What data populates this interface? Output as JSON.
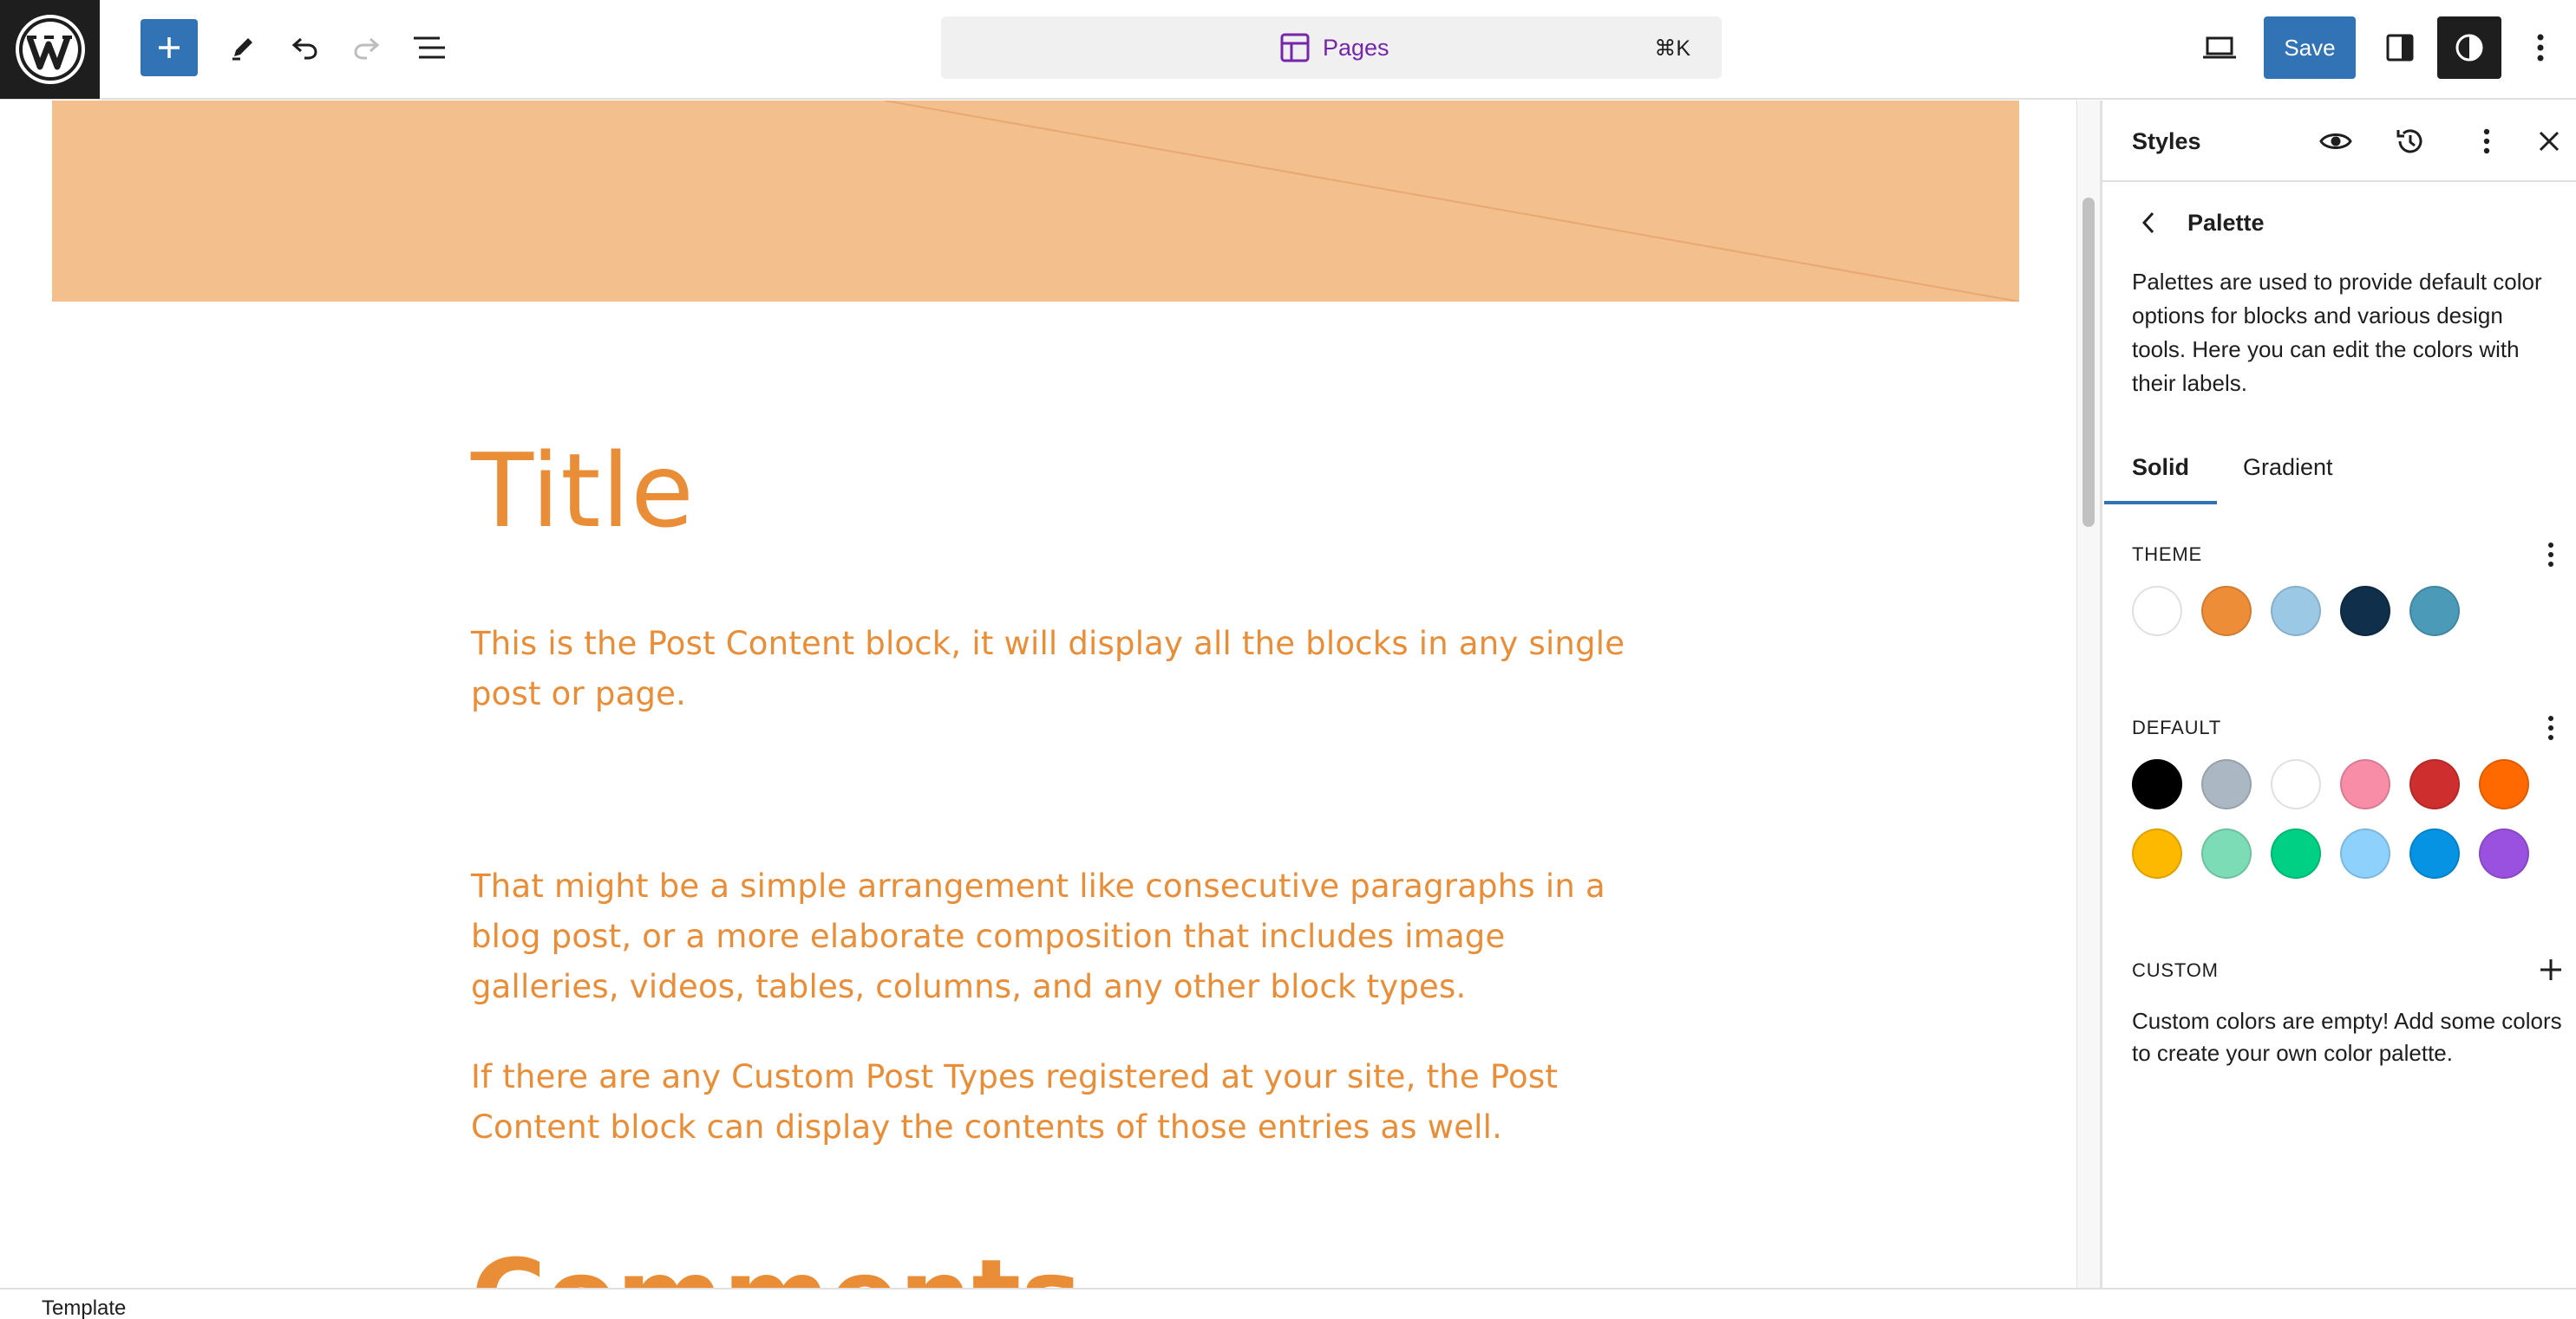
{
  "toolbar": {
    "command_label": "Pages",
    "command_shortcut": "⌘K",
    "save_label": "Save"
  },
  "canvas": {
    "title": "Title",
    "paragraphs": [
      "This is the Post Content block, it will display all the blocks in any single post or page.",
      "That might be a simple arrangement like consecutive paragraphs in a blog post, or a more elaborate composition that includes image galleries, videos, tables, columns, and any other block types.",
      "If there are any Custom Post Types registered at your site, the Post Content block can display the contents of those entries as well."
    ],
    "comments_heading": "Comments",
    "header_color": "#f2bf8d",
    "text_color": "#ea8d37"
  },
  "sidebar": {
    "title": "Styles",
    "palette_title": "Palette",
    "palette_description": "Palettes are used to provide default color options for blocks and various design tools. Here you can edit the colors with their labels.",
    "tabs": [
      "Solid",
      "Gradient"
    ],
    "theme_label": "THEME",
    "theme_colors": [
      "#ffffff",
      "#ee8d37",
      "#9bc9e5",
      "#0f2f4a",
      "#4b9ab8"
    ],
    "default_label": "DEFAULT",
    "default_colors": [
      "#000000",
      "#abb8c3",
      "#ffffff",
      "#f78da7",
      "#cf2e2e",
      "#ff6900",
      "#fcb900",
      "#7bdcb5",
      "#00d084",
      "#8ed1fc",
      "#0693e3",
      "#9b51e0"
    ],
    "custom_label": "CUSTOM",
    "custom_description": "Custom colors are empty! Add some colors to create your own color palette."
  },
  "footer": {
    "breadcrumb": "Template"
  },
  "colors": {
    "accent": "#3173b4",
    "command_text": "#7526ab"
  }
}
